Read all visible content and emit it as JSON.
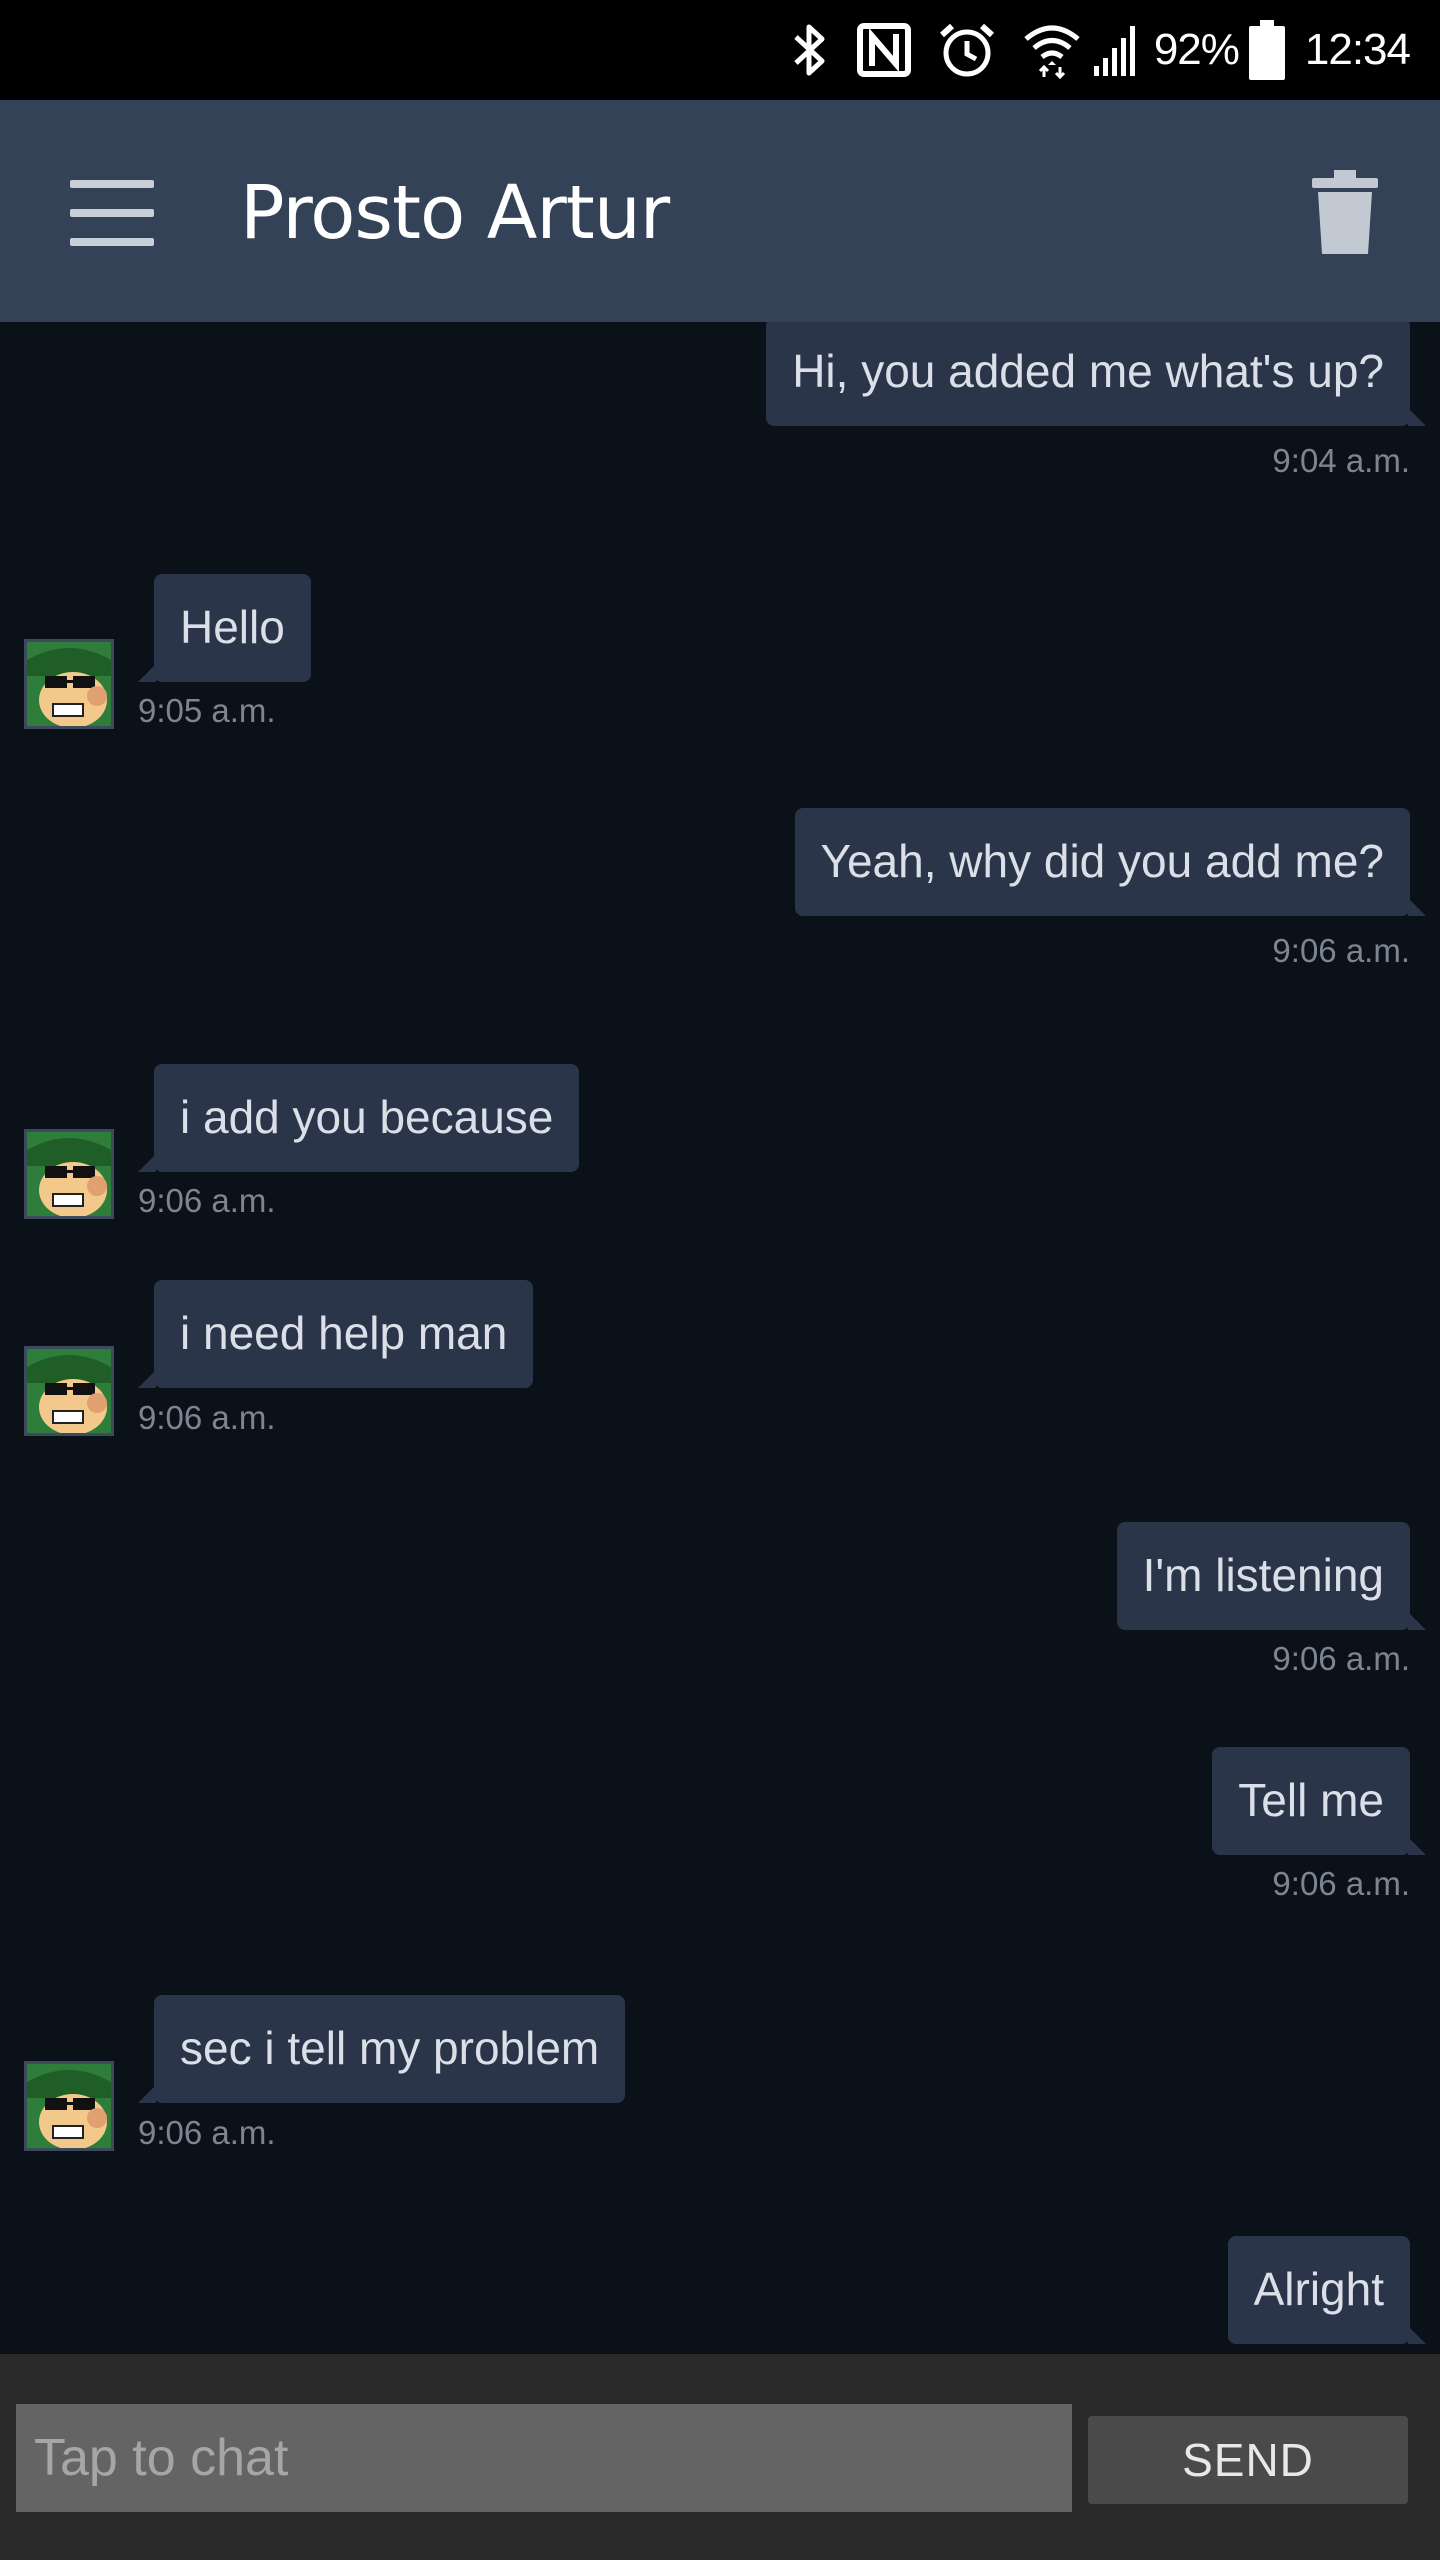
{
  "status_bar": {
    "battery": "92%",
    "time": "12:34",
    "icons": [
      "bluetooth-icon",
      "nfc-icon",
      "alarm-icon",
      "wifi-icon",
      "signal-icon",
      "battery-icon"
    ]
  },
  "header": {
    "title": "Prosto Artur",
    "menu_icon": "hamburger-menu-icon",
    "delete_icon": "trash-icon"
  },
  "messages": [
    {
      "direction": "out",
      "text": "Hi, you added me what's up?",
      "time": "9:04 a.m."
    },
    {
      "direction": "in",
      "text": "Hello",
      "time": "9:05 a.m."
    },
    {
      "direction": "out",
      "text": "Yeah, why did you add me?",
      "time": "9:06 a.m."
    },
    {
      "direction": "in",
      "text": "i add you because",
      "time": "9:06 a.m."
    },
    {
      "direction": "in",
      "text": "i need help man",
      "time": "9:06 a.m."
    },
    {
      "direction": "out",
      "text": "I'm listening",
      "time": "9:06 a.m."
    },
    {
      "direction": "out",
      "text": "Tell me",
      "time": "9:06 a.m."
    },
    {
      "direction": "in",
      "text": "sec i tell my problem",
      "time": "9:06 a.m."
    },
    {
      "direction": "out",
      "text": "Alright",
      "time": ""
    }
  ],
  "input": {
    "placeholder": "Tap to chat",
    "value": "",
    "send_label": "SEND"
  },
  "colors": {
    "background": "#0b1118",
    "header": "#344257",
    "bubble": "#2b3549",
    "input_bar": "#2a2a2a"
  }
}
